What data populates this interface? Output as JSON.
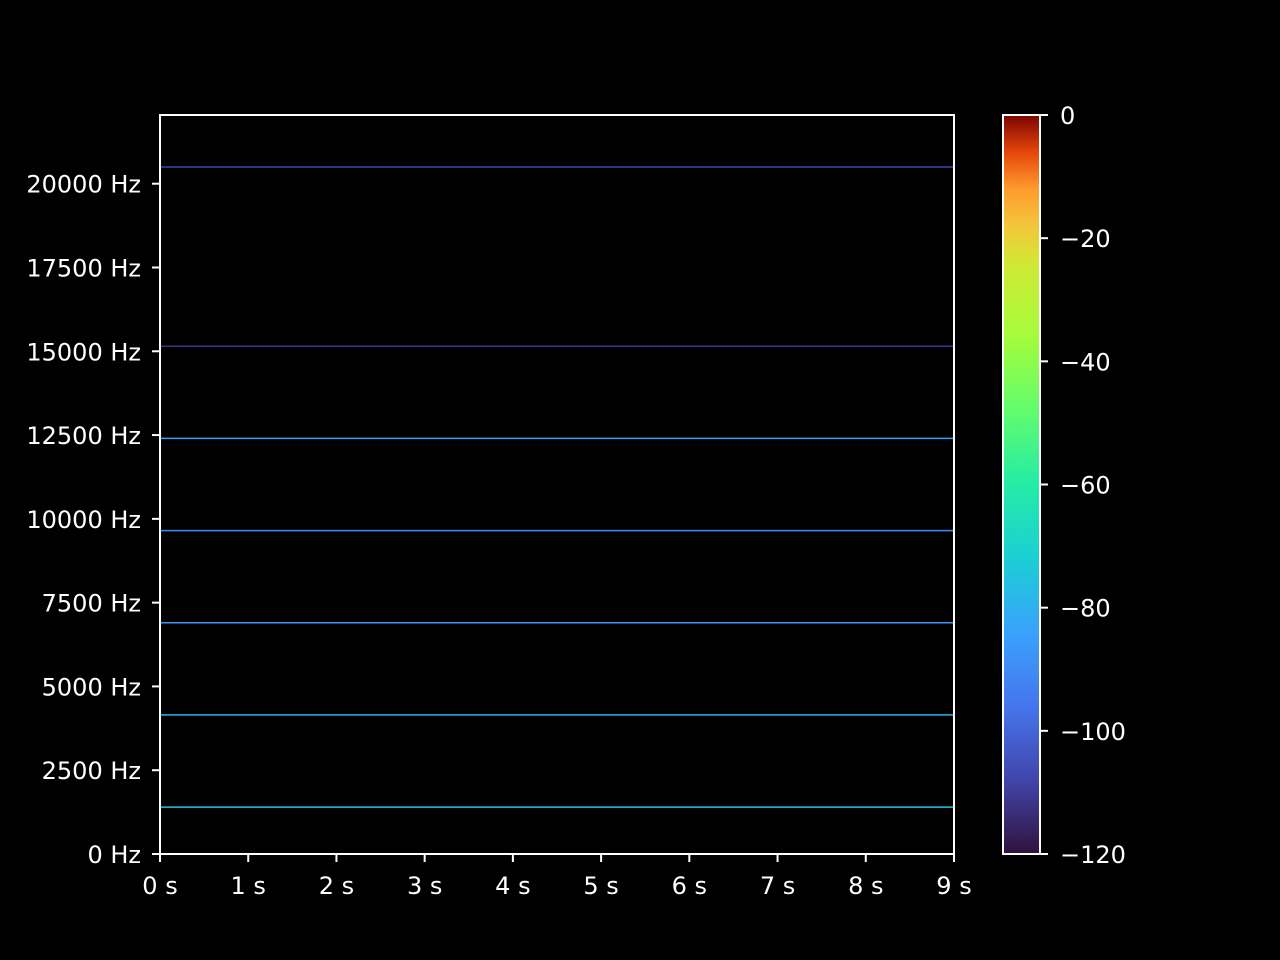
{
  "chart_data": {
    "type": "heatmap",
    "title": "",
    "xlabel": "",
    "ylabel": "",
    "background_color": "#000000",
    "x_unit": "s",
    "y_unit": "Hz",
    "xlim": [
      0,
      9
    ],
    "ylim": [
      0,
      22050
    ],
    "x_ticks": [
      0,
      1,
      2,
      3,
      4,
      5,
      6,
      7,
      8,
      9
    ],
    "x_tick_labels": [
      "0 s",
      "1 s",
      "2 s",
      "3 s",
      "4 s",
      "5 s",
      "6 s",
      "7 s",
      "8 s",
      "9 s"
    ],
    "y_ticks": [
      0,
      2500,
      5000,
      7500,
      10000,
      12500,
      15000,
      17500,
      20000
    ],
    "y_tick_labels": [
      "0 Hz",
      "2500 Hz",
      "5000 Hz",
      "7500 Hz",
      "10000 Hz",
      "12500 Hz",
      "15000 Hz",
      "17500 Hz",
      "20000 Hz"
    ],
    "grid": false,
    "colormap": "turbo",
    "colorbar": {
      "label": "",
      "range": [
        -120,
        0
      ],
      "ticks": [
        0,
        -20,
        -40,
        -60,
        -80,
        -100,
        -120
      ],
      "tick_labels": [
        "0",
        "−20",
        "−40",
        "−60",
        "−80",
        "−100",
        "−120"
      ]
    },
    "series": [
      {
        "frequency": 1400,
        "level": -75,
        "x_range": [
          0,
          9
        ]
      },
      {
        "frequency": 4150,
        "level": -80,
        "x_range": [
          0,
          9
        ]
      },
      {
        "frequency": 6900,
        "level": -88,
        "x_range": [
          0,
          9
        ]
      },
      {
        "frequency": 9650,
        "level": -90,
        "x_range": [
          0,
          9
        ]
      },
      {
        "frequency": 12400,
        "level": -85,
        "x_range": [
          0,
          9
        ]
      },
      {
        "frequency": 15150,
        "level": -112,
        "x_range": [
          0,
          9
        ]
      },
      {
        "frequency": 20500,
        "level": -108,
        "x_range": [
          0,
          9
        ]
      }
    ]
  }
}
